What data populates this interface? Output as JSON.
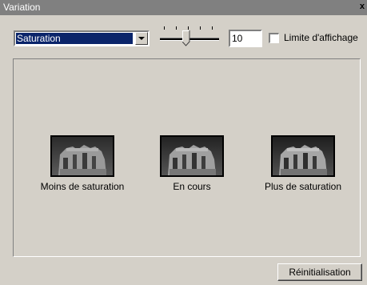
{
  "window": {
    "title": "Variation",
    "close_glyph": "x"
  },
  "toolbar": {
    "mode_select": {
      "value": "Saturation"
    },
    "slider": {
      "ticks": 5,
      "position": 0.4
    },
    "amount": "10",
    "limit_checkbox": {
      "label": "Limite d'affichage",
      "checked": false
    }
  },
  "previews": [
    {
      "caption": "Moins de saturation"
    },
    {
      "caption": "En cours"
    },
    {
      "caption": "Plus de saturation"
    }
  ],
  "footer": {
    "reset_label": "Réinitialisation"
  }
}
